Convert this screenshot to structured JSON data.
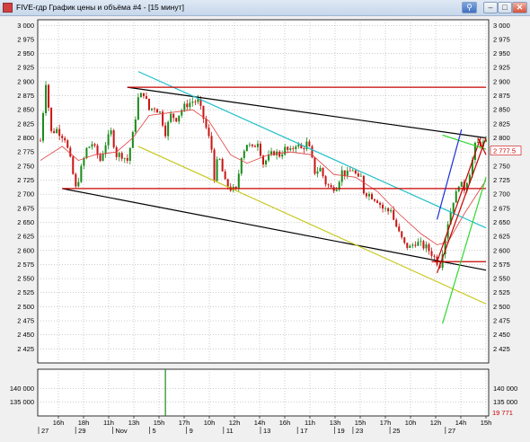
{
  "window": {
    "title": "FIVE-гдр График цены и объёма #4 - [15 минут]",
    "buttons": {
      "pin": "⚲",
      "minimize": "–",
      "maximize": "□",
      "close": "✕"
    }
  },
  "colors": {
    "plot_bg": "#ffffff",
    "candle_up": "#1a8a1a",
    "candle_down": "#c81414",
    "moving_average": "#e04040",
    "channel_black": "#000000",
    "channel_cyan": "#20c0c8",
    "channel_yellow": "#c8c820",
    "level_red": "#c80000",
    "trend_blue": "#1a30d8",
    "trend_green": "#30d830"
  },
  "chart_data": [
    {
      "type": "candlestick",
      "timeframe": "15 минут",
      "ylim": [
        2400,
        3010
      ],
      "y_ticks": [
        "3 000",
        "2 975",
        "2 950",
        "2 925",
        "2 900",
        "2 875",
        "2 850",
        "2 825",
        "2 800",
        "2 775",
        "2 750",
        "2 725",
        "2 700",
        "2 675",
        "2 650",
        "2 625",
        "2 600",
        "2 575",
        "2 550",
        "2 525",
        "2 500",
        "2 475",
        "2 450",
        "2 425"
      ],
      "last_price": "2 777.5",
      "path_points": [
        [
          0,
          2795
        ],
        [
          2,
          2900
        ],
        [
          4,
          2810
        ],
        [
          6,
          2815
        ],
        [
          9,
          2800
        ],
        [
          11,
          2760
        ],
        [
          13,
          2710
        ],
        [
          15,
          2745
        ],
        [
          17,
          2780
        ],
        [
          19,
          2790
        ],
        [
          22,
          2760
        ],
        [
          24,
          2790
        ],
        [
          26,
          2810
        ],
        [
          28,
          2770
        ],
        [
          30,
          2770
        ],
        [
          32,
          2760
        ],
        [
          34,
          2805
        ],
        [
          36,
          2870
        ],
        [
          38,
          2880
        ],
        [
          40,
          2850
        ],
        [
          42,
          2855
        ],
        [
          44,
          2845
        ],
        [
          46,
          2810
        ],
        [
          48,
          2840
        ],
        [
          50,
          2835
        ],
        [
          52,
          2850
        ],
        [
          54,
          2860
        ],
        [
          56,
          2865
        ],
        [
          58,
          2865
        ],
        [
          60,
          2835
        ],
        [
          62,
          2800
        ],
        [
          63,
          2780
        ],
        [
          64,
          2730
        ],
        [
          65,
          2755
        ],
        [
          66,
          2760
        ],
        [
          68,
          2720
        ],
        [
          70,
          2710
        ],
        [
          72,
          2705
        ],
        [
          74,
          2770
        ],
        [
          76,
          2790
        ],
        [
          78,
          2780
        ],
        [
          80,
          2795
        ],
        [
          82,
          2755
        ],
        [
          84,
          2765
        ],
        [
          86,
          2775
        ],
        [
          88,
          2770
        ],
        [
          90,
          2780
        ],
        [
          92,
          2775
        ],
        [
          94,
          2790
        ],
        [
          96,
          2780
        ],
        [
          98,
          2790
        ],
        [
          99,
          2780
        ],
        [
          101,
          2740
        ],
        [
          103,
          2745
        ],
        [
          105,
          2720
        ],
        [
          107,
          2710
        ],
        [
          109,
          2715
        ],
        [
          111,
          2740
        ],
        [
          113,
          2735
        ],
        [
          115,
          2745
        ],
        [
          117,
          2725
        ],
        [
          118,
          2730
        ],
        [
          119,
          2705
        ],
        [
          121,
          2700
        ],
        [
          124,
          2690
        ],
        [
          126,
          2675
        ],
        [
          128,
          2670
        ],
        [
          129,
          2675
        ],
        [
          130,
          2655
        ],
        [
          132,
          2630
        ],
        [
          134,
          2610
        ],
        [
          136,
          2605
        ],
        [
          138,
          2615
        ],
        [
          140,
          2610
        ],
        [
          142,
          2605
        ],
        [
          144,
          2595
        ],
        [
          146,
          2580
        ],
        [
          147,
          2575
        ],
        [
          148,
          2600
        ],
        [
          150,
          2650
        ],
        [
          152,
          2690
        ],
        [
          153,
          2700
        ],
        [
          154,
          2720
        ],
        [
          156,
          2710
        ],
        [
          158,
          2740
        ],
        [
          159,
          2760
        ],
        [
          160,
          2785
        ],
        [
          161,
          2790
        ],
        [
          162,
          2790
        ],
        [
          164,
          2790
        ]
      ],
      "moving_average": [
        [
          0,
          2760
        ],
        [
          8,
          2785
        ],
        [
          14,
          2760
        ],
        [
          20,
          2770
        ],
        [
          28,
          2775
        ],
        [
          34,
          2800
        ],
        [
          40,
          2840
        ],
        [
          48,
          2845
        ],
        [
          56,
          2850
        ],
        [
          62,
          2830
        ],
        [
          70,
          2770
        ],
        [
          76,
          2755
        ],
        [
          84,
          2770
        ],
        [
          92,
          2775
        ],
        [
          100,
          2770
        ],
        [
          108,
          2735
        ],
        [
          116,
          2730
        ],
        [
          124,
          2705
        ],
        [
          132,
          2665
        ],
        [
          140,
          2630
        ],
        [
          146,
          2610
        ],
        [
          150,
          2615
        ],
        [
          156,
          2665
        ],
        [
          164,
          2725
        ]
      ],
      "lines": [
        {
          "name": "black-upper",
          "color": "channel_black",
          "points": [
            [
              32,
              2890
            ],
            [
              164,
              2800
            ]
          ]
        },
        {
          "name": "black-lower",
          "color": "channel_black",
          "points": [
            [
              8,
              2710
            ],
            [
              164,
              2565
            ]
          ]
        },
        {
          "name": "cyan",
          "color": "channel_cyan",
          "points": [
            [
              36,
              2918
            ],
            [
              164,
              2640
            ]
          ]
        },
        {
          "name": "yellow",
          "color": "channel_yellow",
          "points": [
            [
              36,
              2785
            ],
            [
              164,
              2505
            ]
          ]
        },
        {
          "name": "red-h-top",
          "color": "level_red",
          "points": [
            [
              32,
              2890
            ],
            [
              164,
              2890
            ]
          ]
        },
        {
          "name": "red-h-mid",
          "color": "level_red",
          "points": [
            [
              8,
              2710
            ],
            [
              164,
              2710
            ]
          ]
        },
        {
          "name": "red-h-low",
          "color": "level_red",
          "points": [
            [
              144,
              2580
            ],
            [
              164,
              2580
            ]
          ]
        },
        {
          "name": "red-trend-1",
          "color": "level_red",
          "points": [
            [
              146,
              2580
            ],
            [
              162,
              2800
            ]
          ]
        },
        {
          "name": "red-trend-2",
          "color": "level_red",
          "points": [
            [
              146,
              2560
            ],
            [
              164,
              2800
            ]
          ]
        },
        {
          "name": "green-cross",
          "color": "trend_green",
          "points": [
            [
              148,
              2805
            ],
            [
              164,
              2780
            ]
          ]
        },
        {
          "name": "green-steep",
          "color": "trend_green",
          "points": [
            [
              148,
              2470
            ],
            [
              164,
              2730
            ]
          ]
        },
        {
          "name": "blue-steep",
          "color": "trend_blue",
          "points": [
            [
              146,
              2655
            ],
            [
              155,
              2815
            ]
          ]
        },
        {
          "name": "red-seg",
          "color": "level_red",
          "points": [
            [
              161,
              2800
            ],
            [
              164,
              2770
            ]
          ]
        }
      ],
      "x_time_labels": [
        "16h",
        "18h",
        "11h",
        "13h",
        "15h",
        "17h",
        "10h",
        "12h",
        "14h",
        "16h",
        "11h",
        "13h",
        "15h",
        "17h",
        "10h",
        "12h",
        "14h",
        "15h"
      ],
      "x_date_labels": [
        "27",
        "29",
        "Nov",
        "5",
        "9",
        "11",
        "13",
        "17",
        "19",
        "23",
        "25",
        "27"
      ]
    },
    {
      "type": "bar",
      "name": "volume",
      "ylim": [
        130000,
        147000
      ],
      "y_ticks": [
        "140 000",
        "135 000"
      ],
      "right_ticks": [
        "140 000",
        "135 000"
      ],
      "last_value": "19 771",
      "spike_index": 46,
      "spike_value": 147000
    }
  ]
}
